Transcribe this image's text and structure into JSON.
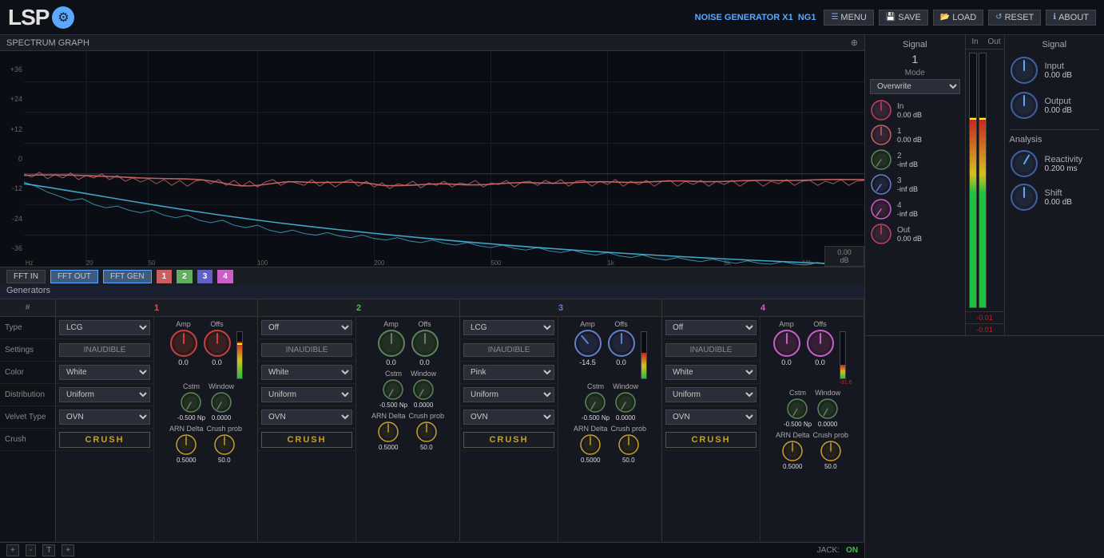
{
  "app": {
    "logo": "LSP",
    "title": "NOISE GENERATOR X1",
    "instance": "NG1"
  },
  "topbar": {
    "menu_label": "MENU",
    "save_label": "SAVE",
    "load_label": "LOAD",
    "reset_label": "RESET",
    "about_label": "ABOUT"
  },
  "spectrum": {
    "title": "SPECTRUM GRAPH",
    "db_label": "dB",
    "hz_label": "Hz",
    "db_val": "0.00",
    "db_unit": "dB",
    "db_ticks": [
      "+36",
      "+24",
      "+12",
      "0",
      "-12",
      "-24",
      "-36"
    ]
  },
  "toolbar": {
    "fft_in": "FFT IN",
    "fft_out": "FFT OUT",
    "fft_gen": "FFT GEN",
    "ch1": "1",
    "ch2": "2",
    "ch3": "3",
    "ch4": "4"
  },
  "generators": {
    "title": "Generators",
    "hash": "#",
    "labels": [
      "Type",
      "Settings",
      "Color",
      "Distribution",
      "Velvet Type",
      "Crush"
    ],
    "channels": [
      {
        "num": "1",
        "type": "LCG",
        "settings": "INAUDIBLE",
        "color": "White",
        "distribution": "Uniform",
        "velvet_type": "OVN",
        "crush": "CRUSH",
        "amp_label": "Amp",
        "amp_val": "0.0",
        "offs_label": "Offs",
        "offs_val": "0.0",
        "cstm_label": "Cstm",
        "cstm_val": "-0.500 Np",
        "window_label": "Window",
        "window_val": "0.0000",
        "arn_label": "ARN Delta",
        "arn_val": "0.5000",
        "crush_prob_label": "Crush prob",
        "crush_prob_val": "50.0",
        "meter_active": true
      },
      {
        "num": "2",
        "type": "Off",
        "settings": "INAUDIBLE",
        "color": "White",
        "distribution": "Uniform",
        "velvet_type": "OVN",
        "crush": "CRUSH",
        "amp_label": "Amp",
        "amp_val": "0.0",
        "offs_label": "Offs",
        "offs_val": "0.0",
        "cstm_label": "Cstm",
        "cstm_val": "-0.500 Np",
        "window_label": "Window",
        "window_val": "0.0000",
        "arn_label": "ARN Delta",
        "arn_val": "0.5000",
        "crush_prob_label": "Crush prob",
        "crush_prob_val": "50.0",
        "meter_active": false
      },
      {
        "num": "3",
        "type": "LCG",
        "settings": "INAUDIBLE",
        "color": "Pink",
        "distribution": "Uniform",
        "velvet_type": "OVN",
        "crush": "CRUSH",
        "amp_label": "Amp",
        "amp_val": "-14.5",
        "offs_label": "Offs",
        "offs_val": "0.0",
        "cstm_label": "Cstm",
        "cstm_val": "-0.500 Np",
        "window_label": "Window",
        "window_val": "0.0000",
        "arn_label": "ARN Delta",
        "arn_val": "0.5000",
        "crush_prob_label": "Crush prob",
        "crush_prob_val": "50.0",
        "meter_active": true
      },
      {
        "num": "4",
        "type": "Off",
        "settings": "INAUDIBLE",
        "color": "White",
        "distribution": "Uniform",
        "velvet_type": "OVN",
        "crush": "CRUSH",
        "amp_label": "Amp",
        "amp_val": "0.0",
        "offs_label": "Offs",
        "offs_val": "0.0",
        "cstm_label": "Cstm",
        "cstm_val": "-0.500 Np",
        "window_label": "Window",
        "window_val": "0.0000",
        "arn_label": "ARN Delta",
        "arn_val": "0.5000",
        "crush_prob_label": "Crush prob",
        "crush_prob_val": "50.0",
        "meter_val": "-31.6",
        "meter_active": false
      }
    ]
  },
  "signal_panel": {
    "title": "Signal",
    "ch_num": "1",
    "mode_label": "Mode",
    "mode_value": "Overwrite",
    "in_label": "In",
    "out_label": "Out",
    "inputs": [
      {
        "label": "In",
        "value": "0.00 dB"
      },
      {
        "label": "1",
        "value": "0.00 dB"
      },
      {
        "label": "2",
        "value": "-inf dB"
      },
      {
        "label": "3",
        "value": "-inf dB"
      },
      {
        "label": "4",
        "value": "-inf dB"
      },
      {
        "label": "Out",
        "value": "0.00 dB"
      }
    ],
    "meter_val": "-0.01",
    "meter_val2": "-0.01"
  },
  "right_panel": {
    "title": "Signal",
    "input_label": "Input",
    "input_val": "0.00 dB",
    "output_label": "Output",
    "output_val": "0.00 dB",
    "analysis_title": "Analysis",
    "reactivity_label": "Reactivity",
    "reactivity_val": "0.200 ms",
    "shift_label": "Shift",
    "shift_val": "0.00 dB"
  },
  "bottom": {
    "add_label": "+",
    "remove_label": "-",
    "t_label": "T",
    "add2_label": "+",
    "jack_label": "JACK:",
    "jack_status": "ON"
  },
  "colors": {
    "accent": "#5ba8ff",
    "bg_dark": "#0a0e14",
    "bg_mid": "#151820",
    "bg_light": "#1a1e24",
    "border": "#333333",
    "ch1": "#c86060",
    "ch2": "#60b060",
    "ch3": "#6060c8",
    "ch4": "#c860c8",
    "knob_amp": "#c84040",
    "knob_green": "#608060",
    "knob_blue": "#4060a0",
    "crush_color": "#c8a020",
    "text_muted": "#888888"
  }
}
